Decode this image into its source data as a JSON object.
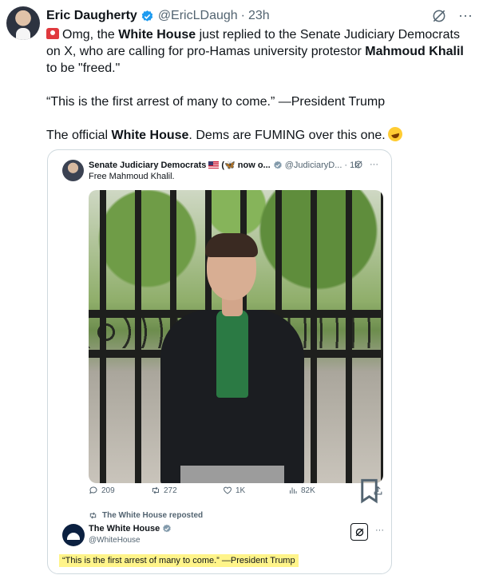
{
  "tweet": {
    "author_name": "Eric Daugherty",
    "handle": "@EricLDaugh",
    "separator": "·",
    "time": "23h",
    "more_label": "···",
    "text_part1": "Omg, the ",
    "text_bold1": "White House",
    "text_part2": " just replied to the Senate Judiciary Democrats on X, who are calling for pro-Hamas university protestor ",
    "text_bold2": "Mahmoud Khalil",
    "text_part3": " to be \"freed.\"",
    "quote_line": "“This is the first arrest of many to come.” —President Trump",
    "closing_part1": "The official ",
    "closing_bold": "White House",
    "closing_part2": ". Dems are FUMING over this one."
  },
  "quoted_tweet": {
    "author_name": "Senate Judiciary Democrats",
    "name_suffix": "(🦋 now o...",
    "handle": "@JudiciaryD...",
    "separator": "·",
    "time": "1h",
    "more_label": "···",
    "text": "Free Mahmoud Khalil.",
    "stats": {
      "replies": "209",
      "reposts": "272",
      "likes": "1K",
      "views": "82K"
    }
  },
  "reply": {
    "reposted_label": "The White House reposted",
    "author_name": "The White House",
    "handle": "@WhiteHouse",
    "more_label": "···",
    "text": "“This is the first arrest of many to come.” —President Trump"
  },
  "colors": {
    "verified": "#1d9bf0",
    "muted": "#536471",
    "highlight": "#fff48a",
    "border": "#cfd9de"
  }
}
